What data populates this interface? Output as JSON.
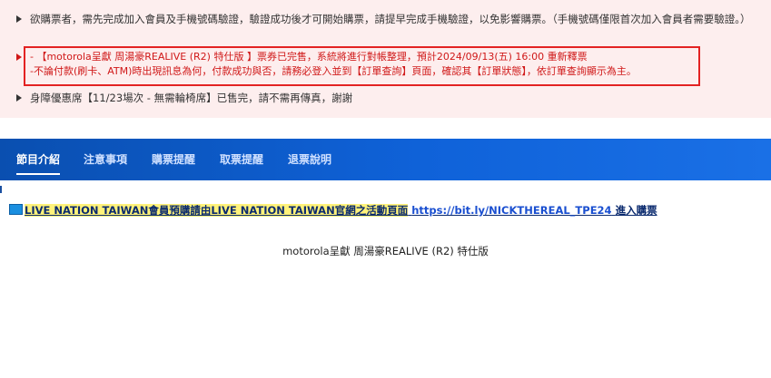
{
  "notices": {
    "item1": "欲購票者，需先完成加入會員及手機號碼驗證，驗證成功後才可開始購票，請提早完成手機驗證，以免影響購票。（手機號碼僅限首次加入會員者需要驗證。）",
    "item2_line1": "- 【motorola呈獻 周湯豪REALIVE (R2) 特仕版 】票券已完售，系統將進行對帳整理，預計2024/09/13(五) 16:00 重新釋票",
    "item2_line2": "-不論付款(刷卡、ATM)時出現訊息為何，付款成功與否，請務必登入並到【訂單查詢】頁面，確認其【訂單狀態】，依訂單查詢顯示為主。",
    "item3": "身障優惠席【11/23場次 - 無需輪椅席】已售完，請不需再傳真，謝謝"
  },
  "tabs": [
    {
      "label": "節目介紹",
      "active": true
    },
    {
      "label": "注意事項",
      "active": false
    },
    {
      "label": "購票提醒",
      "active": false
    },
    {
      "label": "取票提醒",
      "active": false
    },
    {
      "label": "退票說明",
      "active": false
    }
  ],
  "promo": {
    "icon": "book-icon",
    "text": "LIVE NATION TAIWAN會員預購請由LIVE NATION TAIWAN官網之活動頁面",
    "link": "https://bit.ly/NICKTHEREAL_TPE24",
    "suffix": "進入購票"
  },
  "event_title": "motorola呈獻 周湯豪REALIVE (R2) 特仕版",
  "colors": {
    "tab_bar": "#0f62d9",
    "alert_red": "#d01818",
    "notice_bg": "#fdeeee"
  }
}
